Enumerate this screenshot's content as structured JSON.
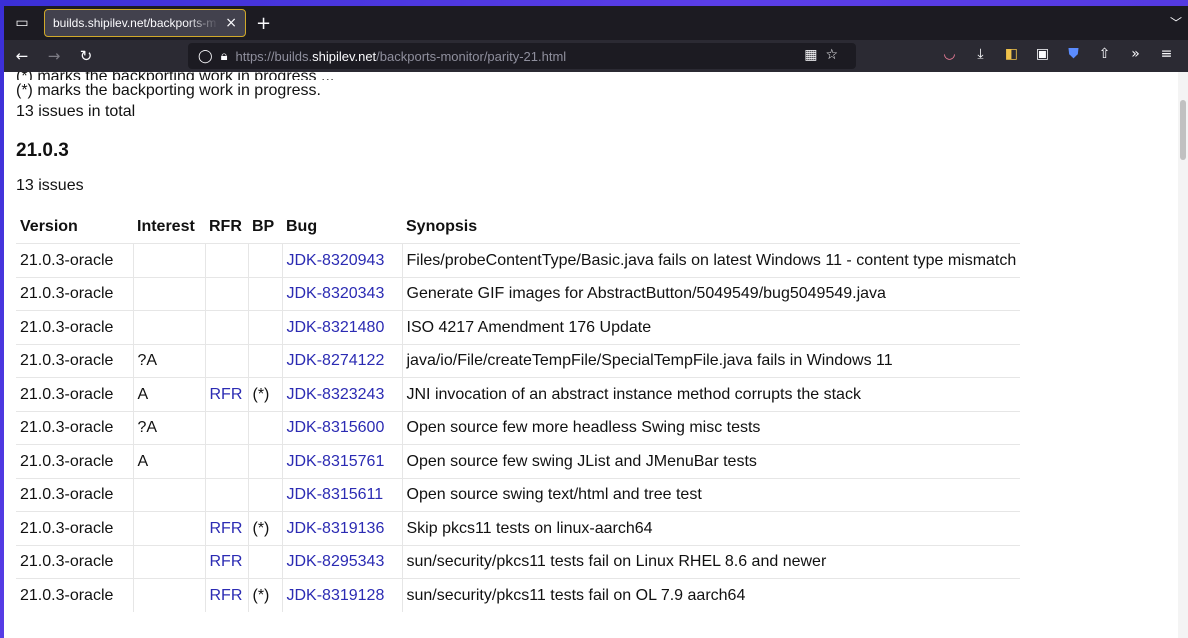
{
  "browser": {
    "tab_title": "builds.shipilev.net/backports-m",
    "tab_close": "×",
    "new_tab": "+",
    "url_prefix": "https://builds.",
    "url_host": "shipilev.net",
    "url_path": "/backports-monitor/parity-21.html"
  },
  "page": {
    "partial_line": "(*) marks the backporting work in progress ...",
    "note": "(*) marks the backporting work in progress.",
    "total": "13 issues in total",
    "section_title": "21.0.3",
    "section_count": "13 issues",
    "headers": {
      "version": "Version",
      "interest": "Interest",
      "rfr": "RFR",
      "bp": "BP",
      "bug": "Bug",
      "synopsis": "Synopsis"
    },
    "rows": [
      {
        "version": "21.0.3-oracle",
        "interest": "",
        "rfr": "",
        "bp": "",
        "bug": "JDK-8320943",
        "synopsis": "Files/probeContentType/Basic.java fails on latest Windows 11 - content type mismatch"
      },
      {
        "version": "21.0.3-oracle",
        "interest": "",
        "rfr": "",
        "bp": "",
        "bug": "JDK-8320343",
        "synopsis": "Generate GIF images for AbstractButton/5049549/bug5049549.java"
      },
      {
        "version": "21.0.3-oracle",
        "interest": "",
        "rfr": "",
        "bp": "",
        "bug": "JDK-8321480",
        "synopsis": "ISO 4217 Amendment 176 Update"
      },
      {
        "version": "21.0.3-oracle",
        "interest": "?A",
        "rfr": "",
        "bp": "",
        "bug": "JDK-8274122",
        "synopsis": "java/io/File/createTempFile/SpecialTempFile.java fails in Windows 11"
      },
      {
        "version": "21.0.3-oracle",
        "interest": "A",
        "rfr": "RFR",
        "bp": "(*)",
        "bug": "JDK-8323243",
        "synopsis": "JNI invocation of an abstract instance method corrupts the stack"
      },
      {
        "version": "21.0.3-oracle",
        "interest": "?A",
        "rfr": "",
        "bp": "",
        "bug": "JDK-8315600",
        "synopsis": "Open source few more headless Swing misc tests"
      },
      {
        "version": "21.0.3-oracle",
        "interest": "A",
        "rfr": "",
        "bp": "",
        "bug": "JDK-8315761",
        "synopsis": "Open source few swing JList and JMenuBar tests"
      },
      {
        "version": "21.0.3-oracle",
        "interest": "",
        "rfr": "",
        "bp": "",
        "bug": "JDK-8315611",
        "synopsis": "Open source swing text/html and tree test"
      },
      {
        "version": "21.0.3-oracle",
        "interest": "",
        "rfr": "RFR",
        "bp": "(*)",
        "bug": "JDK-8319136",
        "synopsis": "Skip pkcs11 tests on linux-aarch64"
      },
      {
        "version": "21.0.3-oracle",
        "interest": "",
        "rfr": "RFR",
        "bp": "",
        "bug": "JDK-8295343",
        "synopsis": "sun/security/pkcs11 tests fail on Linux RHEL 8.6 and newer"
      },
      {
        "version": "21.0.3-oracle",
        "interest": "",
        "rfr": "RFR",
        "bp": "(*)",
        "bug": "JDK-8319128",
        "synopsis": "sun/security/pkcs11 tests fail on OL 7.9 aarch64"
      }
    ]
  }
}
